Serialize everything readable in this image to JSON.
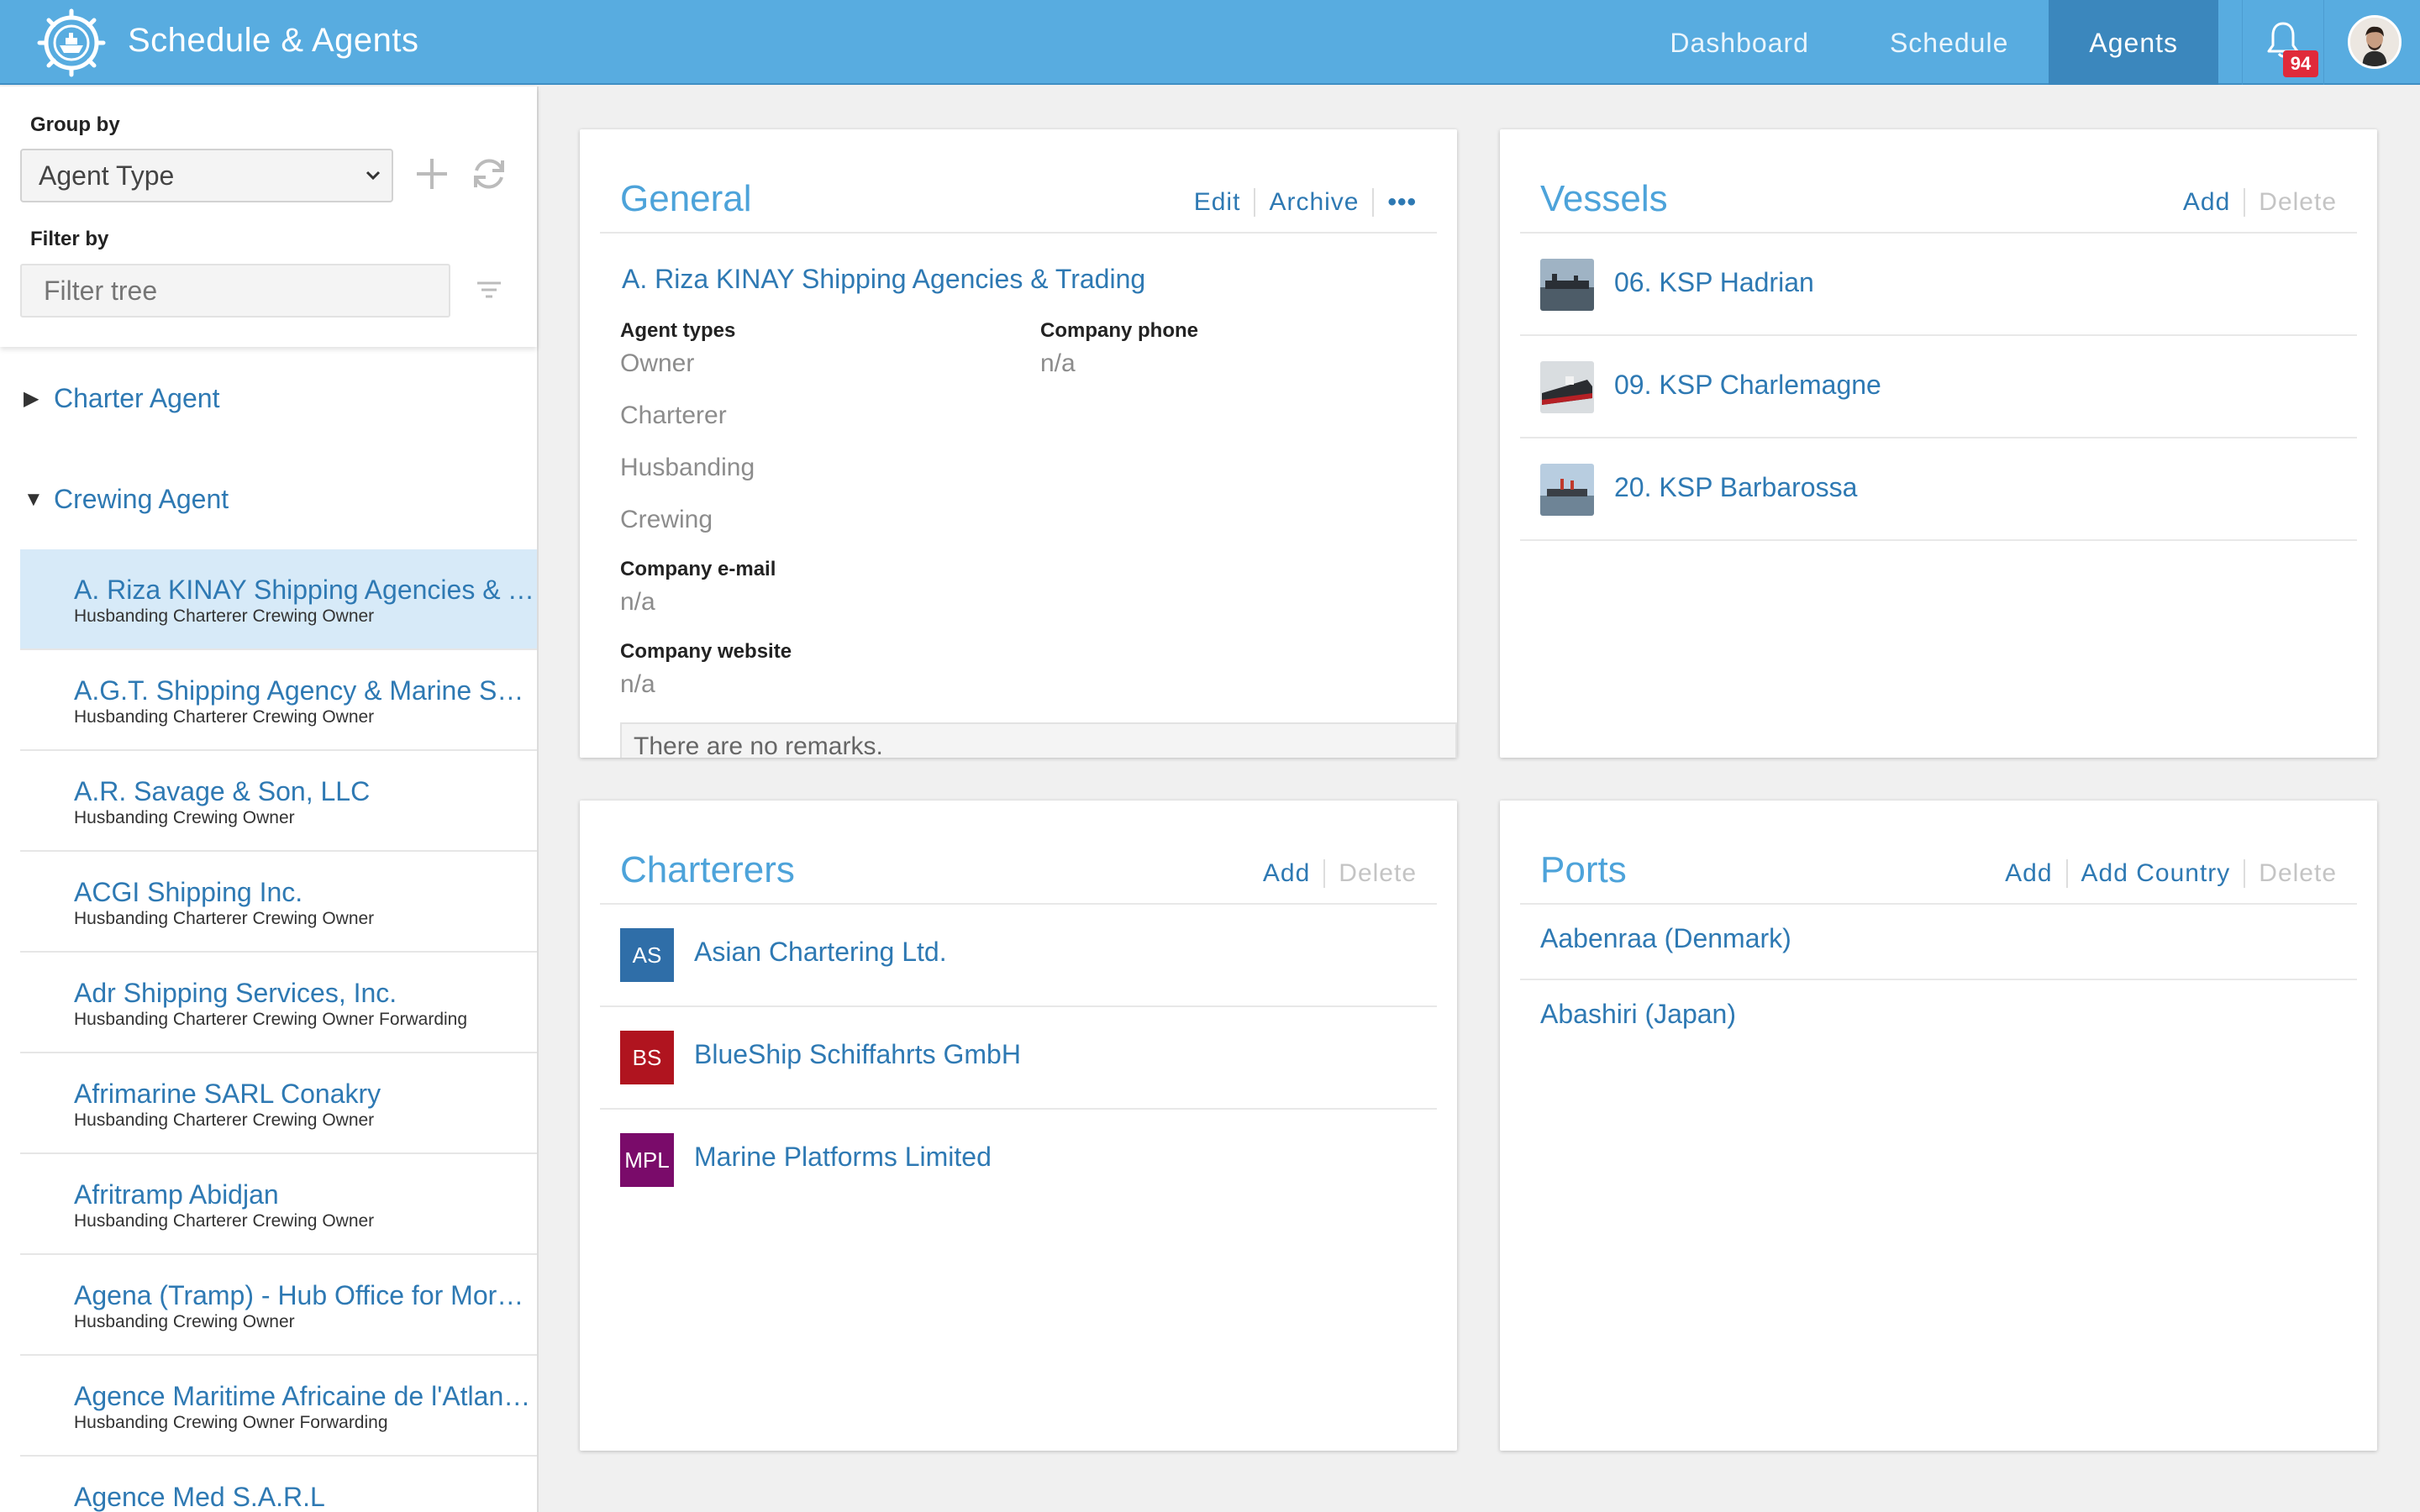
{
  "app": {
    "title": "Schedule & Agents",
    "nav": [
      "Dashboard",
      "Schedule",
      "Agents"
    ],
    "active_nav": "Agents",
    "notification_count": "94",
    "brand_color": "#58ace0",
    "accent_color": "#2e79b3"
  },
  "sidebar": {
    "group_by_label": "Group by",
    "group_by_value": "Agent Type",
    "filter_by_label": "Filter by",
    "filter_placeholder": "Filter tree",
    "groups": [
      {
        "label": "Charter Agent",
        "expanded": false
      },
      {
        "label": "Crewing Agent",
        "expanded": true
      }
    ],
    "items": [
      {
        "name": "A. Riza KINAY Shipping Agencies & Trading",
        "types": "Husbanding Charterer Crewing Owner",
        "selected": true
      },
      {
        "name": "A.G.T. Shipping Agency & Marine Services",
        "types": "Husbanding Charterer Crewing Owner"
      },
      {
        "name": "A.R. Savage & Son, LLC",
        "types": "Husbanding Crewing Owner"
      },
      {
        "name": "ACGI Shipping Inc.",
        "types": "Husbanding Charterer Crewing Owner"
      },
      {
        "name": "Adr Shipping Services, Inc.",
        "types": "Husbanding Charterer Crewing Owner Forwarding"
      },
      {
        "name": "Afrimarine SARL Conakry",
        "types": "Husbanding Charterer Crewing Owner"
      },
      {
        "name": "Afritramp Abidjan",
        "types": "Husbanding Charterer Crewing Owner"
      },
      {
        "name": "Agena (Tramp) - Hub Office for Morocco",
        "types": "Husbanding Crewing Owner"
      },
      {
        "name": "Agence Maritime Africaine de l'Atlantique",
        "types": "Husbanding Crewing Owner Forwarding"
      },
      {
        "name": "Agence Med S.A.R.L",
        "types": ""
      }
    ]
  },
  "general": {
    "title": "General",
    "actions": {
      "edit": "Edit",
      "archive": "Archive",
      "more": "•••"
    },
    "company_name": "A. Riza KINAY Shipping Agencies & Trading",
    "agent_types_label": "Agent types",
    "agent_types": [
      "Owner",
      "Charterer",
      "Husbanding",
      "Crewing"
    ],
    "phone_label": "Company phone",
    "phone": "n/a",
    "email_label": "Company e-mail",
    "email": "n/a",
    "website_label": "Company website",
    "website": "n/a",
    "remarks": "There are no remarks."
  },
  "vessels": {
    "title": "Vessels",
    "add": "Add",
    "delete": "Delete",
    "items": [
      "06. KSP Hadrian",
      "09. KSP Charlemagne",
      "20. KSP Barbarossa"
    ]
  },
  "charterers": {
    "title": "Charterers",
    "add": "Add",
    "delete": "Delete",
    "items": [
      {
        "abbr": "AS",
        "name": "Asian Chartering Ltd.",
        "color": "#2f6ea8"
      },
      {
        "abbr": "BS",
        "name": "BlueShip Schiffahrts GmbH",
        "color": "#b0141f"
      },
      {
        "abbr": "MPL",
        "name": "Marine Platforms Limited",
        "color": "#7a0b6a"
      }
    ]
  },
  "ports": {
    "title": "Ports",
    "add": "Add",
    "add_country": "Add Country",
    "delete": "Delete",
    "items": [
      "Aabenraa (Denmark)",
      "Abashiri (Japan)"
    ]
  }
}
